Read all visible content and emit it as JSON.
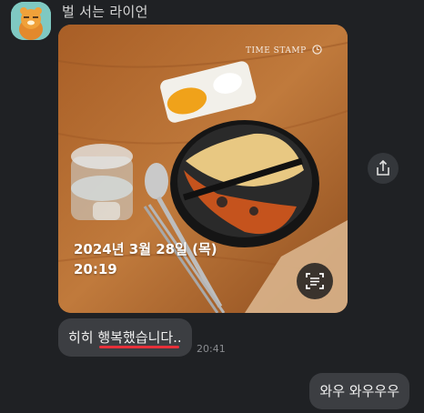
{
  "chat": {
    "sender_name": "벌 서는 라이언",
    "photo": {
      "watermark": "TIME STAMP",
      "date_text": "2024년 3월 28일 (목)",
      "time_text": "20:19"
    },
    "messages": [
      {
        "text": "히히 행복했습니다..",
        "time": "20:41",
        "direction": "incoming"
      },
      {
        "text": "와우 와우우우",
        "direction": "outgoing"
      }
    ]
  },
  "colors": {
    "background": "#1f2124",
    "bubble": "#3c3e42",
    "underline": "#e8303a",
    "avatar_bg": "#7fc9c2"
  },
  "icons": [
    "avatar-character",
    "clock-icon",
    "scan-text-icon",
    "share-icon"
  ]
}
